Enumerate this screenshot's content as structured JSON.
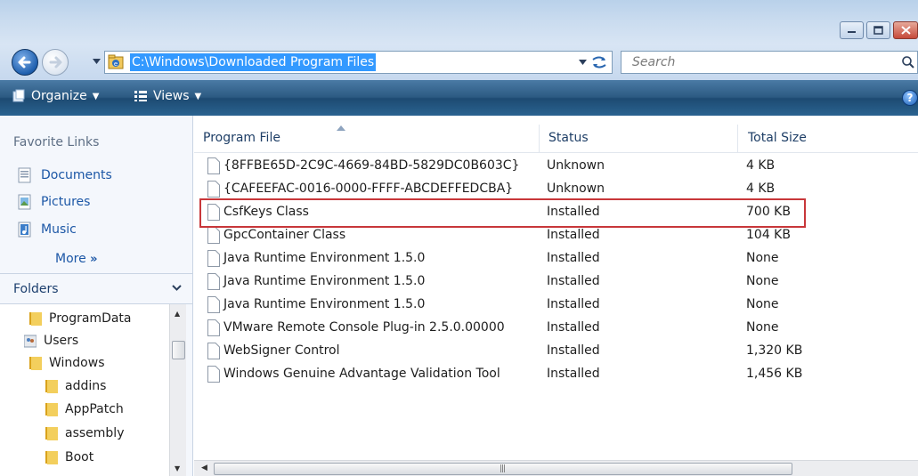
{
  "address": {
    "path": "C:\\Windows\\Downloaded Program Files"
  },
  "search": {
    "placeholder": "Search"
  },
  "toolbar": {
    "organize_label": "Organize",
    "views_label": "Views"
  },
  "nav": {
    "favorites_title": "Favorite Links",
    "favorites": [
      {
        "label": "Documents",
        "icon": "documents-icon"
      },
      {
        "label": "Pictures",
        "icon": "pictures-icon"
      },
      {
        "label": "Music",
        "icon": "music-icon"
      }
    ],
    "more_label": "More",
    "more_glyph": "»",
    "folders_title": "Folders",
    "folders": [
      {
        "label": "ProgramData",
        "level": 0
      },
      {
        "label": "Users",
        "level": 0
      },
      {
        "label": "Windows",
        "level": 0
      },
      {
        "label": "addins",
        "level": 1
      },
      {
        "label": "AppPatch",
        "level": 1
      },
      {
        "label": "assembly",
        "level": 1
      },
      {
        "label": "Boot",
        "level": 1
      }
    ]
  },
  "columns": {
    "program_file": "Program File",
    "status": "Status",
    "total_size": "Total Size"
  },
  "files": [
    {
      "name": "{8FFBE65D-2C9C-4669-84BD-5829DC0B603C}",
      "status": "Unknown",
      "size": "4 KB"
    },
    {
      "name": "{CAFEEFAC-0016-0000-FFFF-ABCDEFFEDCBA}",
      "status": "Unknown",
      "size": "4 KB"
    },
    {
      "name": "CsfKeys Class",
      "status": "Installed",
      "size": "700 KB"
    },
    {
      "name": "GpcContainer Class",
      "status": "Installed",
      "size": "104 KB"
    },
    {
      "name": "Java Runtime Environment 1.5.0",
      "status": "Installed",
      "size": "None"
    },
    {
      "name": "Java Runtime Environment 1.5.0",
      "status": "Installed",
      "size": "None"
    },
    {
      "name": "Java Runtime Environment 1.5.0",
      "status": "Installed",
      "size": "None"
    },
    {
      "name": "VMware Remote Console Plug-in 2.5.0.00000",
      "status": "Installed",
      "size": "None"
    },
    {
      "name": "WebSigner Control",
      "status": "Installed",
      "size": "1,320 KB"
    },
    {
      "name": "Windows Genuine Advantage Validation Tool",
      "status": "Installed",
      "size": "1,456 KB"
    }
  ],
  "highlighted_row_index": 2,
  "colors": {
    "highlight_border": "#c8373a",
    "link": "#1c57a6",
    "selection": "#3399ff"
  }
}
